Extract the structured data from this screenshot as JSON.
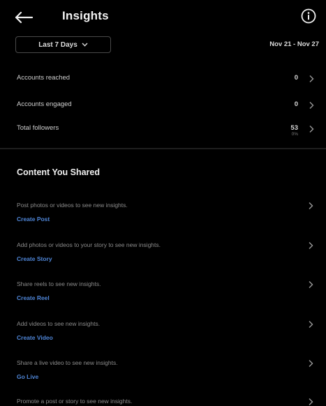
{
  "header": {
    "title": "Insights",
    "back_icon": "arrow-left-icon",
    "info_icon": "info-icon"
  },
  "range": {
    "selected": "Last 7 Days",
    "dates": "Nov 21 - Nov 27"
  },
  "metrics": [
    {
      "label": "Accounts reached",
      "value": "0"
    },
    {
      "label": "Accounts engaged",
      "value": "0"
    },
    {
      "label": "Total followers",
      "value": "53",
      "sub": "0%"
    }
  ],
  "section": {
    "title": "Content You Shared"
  },
  "content": [
    {
      "desc": "Post photos or videos to see new insights.",
      "link": "Create Post"
    },
    {
      "desc": "Add photos or videos to your story to see new insights.",
      "link": "Create Story"
    },
    {
      "desc": "Share reels to see new insights.",
      "link": "Create Reel"
    },
    {
      "desc": "Add videos to see new insights.",
      "link": "Create Video"
    },
    {
      "desc": "Share a live video to see new insights.",
      "link": "Go Live"
    },
    {
      "desc": "Promote a post or story to see new insights.",
      "link": ""
    }
  ],
  "colors": {
    "background": "#000000",
    "link": "#4f86d8",
    "divider": "#1e1e1e"
  }
}
